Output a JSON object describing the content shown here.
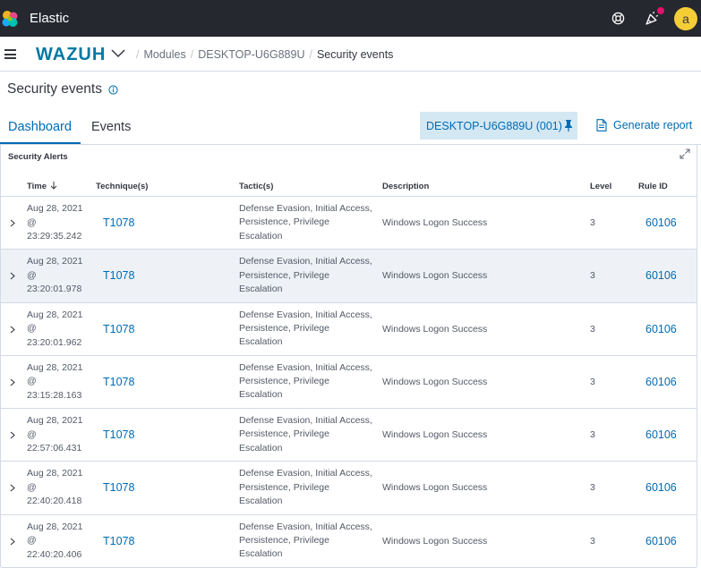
{
  "header": {
    "app_title": "Elastic",
    "avatar_initial": "a",
    "icons": [
      "elastic-logo",
      "help-icon",
      "newsfeed-icon"
    ]
  },
  "navbar": {
    "brand": "WAZUH",
    "breadcrumbs": [
      "Modules",
      "DESKTOP-U6G889U",
      "Security events"
    ]
  },
  "page": {
    "title": "Security events"
  },
  "tabs": {
    "items": [
      {
        "label": "Dashboard",
        "active": true
      },
      {
        "label": "Events",
        "active": false
      }
    ],
    "agent_chip": "DESKTOP-U6G889U (001)",
    "report_label": "Generate report"
  },
  "panel": {
    "title": "Security Alerts",
    "columns": [
      "Time",
      "Technique(s)",
      "Tactic(s)",
      "Description",
      "Level",
      "Rule ID"
    ],
    "rows": [
      {
        "date": "Aug 28, 2021",
        "at": "@",
        "clock": "23:29:35.242",
        "technique": "T1078",
        "tactic": "Defense Evasion, Initial Access, Persistence, Privilege Escalation",
        "description": "Windows Logon Success",
        "level": "3",
        "rule_id": "60106"
      },
      {
        "date": "Aug 28, 2021",
        "at": "@",
        "clock": "23:20:01.978",
        "technique": "T1078",
        "tactic": "Defense Evasion, Initial Access, Persistence, Privilege Escalation",
        "description": "Windows Logon Success",
        "level": "3",
        "rule_id": "60106"
      },
      {
        "date": "Aug 28, 2021",
        "at": "@",
        "clock": "23:20:01.962",
        "technique": "T1078",
        "tactic": "Defense Evasion, Initial Access, Persistence, Privilege Escalation",
        "description": "Windows Logon Success",
        "level": "3",
        "rule_id": "60106"
      },
      {
        "date": "Aug 28, 2021",
        "at": "@",
        "clock": "23:15:28.163",
        "technique": "T1078",
        "tactic": "Defense Evasion, Initial Access, Persistence, Privilege Escalation",
        "description": "Windows Logon Success",
        "level": "3",
        "rule_id": "60106"
      },
      {
        "date": "Aug 28, 2021",
        "at": "@",
        "clock": "22:57:06.431",
        "technique": "T1078",
        "tactic": "Defense Evasion, Initial Access, Persistence, Privilege Escalation",
        "description": "Windows Logon Success",
        "level": "3",
        "rule_id": "60106"
      },
      {
        "date": "Aug 28, 2021",
        "at": "@",
        "clock": "22:40:20.418",
        "technique": "T1078",
        "tactic": "Defense Evasion, Initial Access, Persistence, Privilege Escalation",
        "description": "Windows Logon Success",
        "level": "3",
        "rule_id": "60106"
      },
      {
        "date": "Aug 28, 2021",
        "at": "@",
        "clock": "22:40:20.406",
        "technique": "T1078",
        "tactic": "Defense Evasion, Initial Access, Persistence, Privilege Escalation",
        "description": "Windows Logon Success",
        "level": "3",
        "rule_id": "60106"
      }
    ]
  }
}
